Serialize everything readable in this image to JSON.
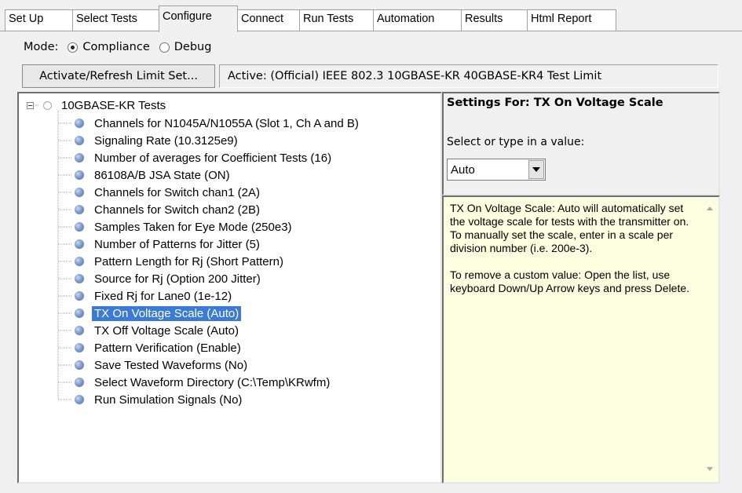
{
  "tabs": [
    {
      "label": "Set Up"
    },
    {
      "label": "Select Tests"
    },
    {
      "label": "Configure"
    },
    {
      "label": "Connect"
    },
    {
      "label": "Run Tests"
    },
    {
      "label": "Automation"
    },
    {
      "label": "Results"
    },
    {
      "label": "Html Report"
    }
  ],
  "active_tab": "Configure",
  "mode": {
    "label": "Mode:",
    "options": [
      {
        "label": "Compliance",
        "checked": true
      },
      {
        "label": "Debug",
        "checked": false
      }
    ]
  },
  "limit_set": {
    "button_label": "Activate/Refresh Limit Set...",
    "active_text": "Active:  (Official) IEEE 802.3 10GBASE-KR 40GBASE-KR4 Test Limit"
  },
  "tree": {
    "root_label": "10GBASE-KR Tests",
    "items": [
      {
        "label": "Channels for N1045A/N1055A (Slot 1, Ch A and B)"
      },
      {
        "label": "Signaling Rate (10.3125e9)"
      },
      {
        "label": "Number of averages for Coefficient Tests (16)"
      },
      {
        "label": "86108A/B JSA State (ON)"
      },
      {
        "label": "Channels for Switch chan1 (2A)"
      },
      {
        "label": "Channels for Switch chan2 (2B)"
      },
      {
        "label": "Samples Taken for Eye Mode (250e3)"
      },
      {
        "label": "Number of Patterns for Jitter (5)"
      },
      {
        "label": "Pattern Length for Rj (Short Pattern)"
      },
      {
        "label": "Source for Rj (Option 200 Jitter)"
      },
      {
        "label": "Fixed Rj for Lane0 (1e-12)"
      },
      {
        "label": "TX On Voltage Scale (Auto)",
        "selected": true
      },
      {
        "label": "TX Off Voltage Scale (Auto)"
      },
      {
        "label": "Pattern Verification (Enable)"
      },
      {
        "label": "Save Tested Waveforms (No)"
      },
      {
        "label": "Select Waveform Directory (C:\\Temp\\KRwfm)"
      },
      {
        "label": "Run Simulation Signals (No)"
      }
    ]
  },
  "settings": {
    "title": "Settings For: TX On Voltage Scale",
    "prompt": "Select or type in a value:",
    "value": "Auto"
  },
  "help": {
    "paragraph1": "TX On Voltage Scale: Auto will automatically set the voltage scale for tests with the transmitter on. To manually set the scale, enter in a scale per division number (i.e. 200e-3).",
    "paragraph2": "To remove a custom value: Open the list, use keyboard Down/Up Arrow keys and press Delete."
  },
  "colors": {
    "selection": "#3a7bd5",
    "help_background": "#fdfde0",
    "window_background": "#f0f0f0"
  },
  "icons": {
    "tree_item": "blue-ball-icon",
    "tree_root": "hollow-circle-icon",
    "expander": "collapse-minus-icon"
  }
}
